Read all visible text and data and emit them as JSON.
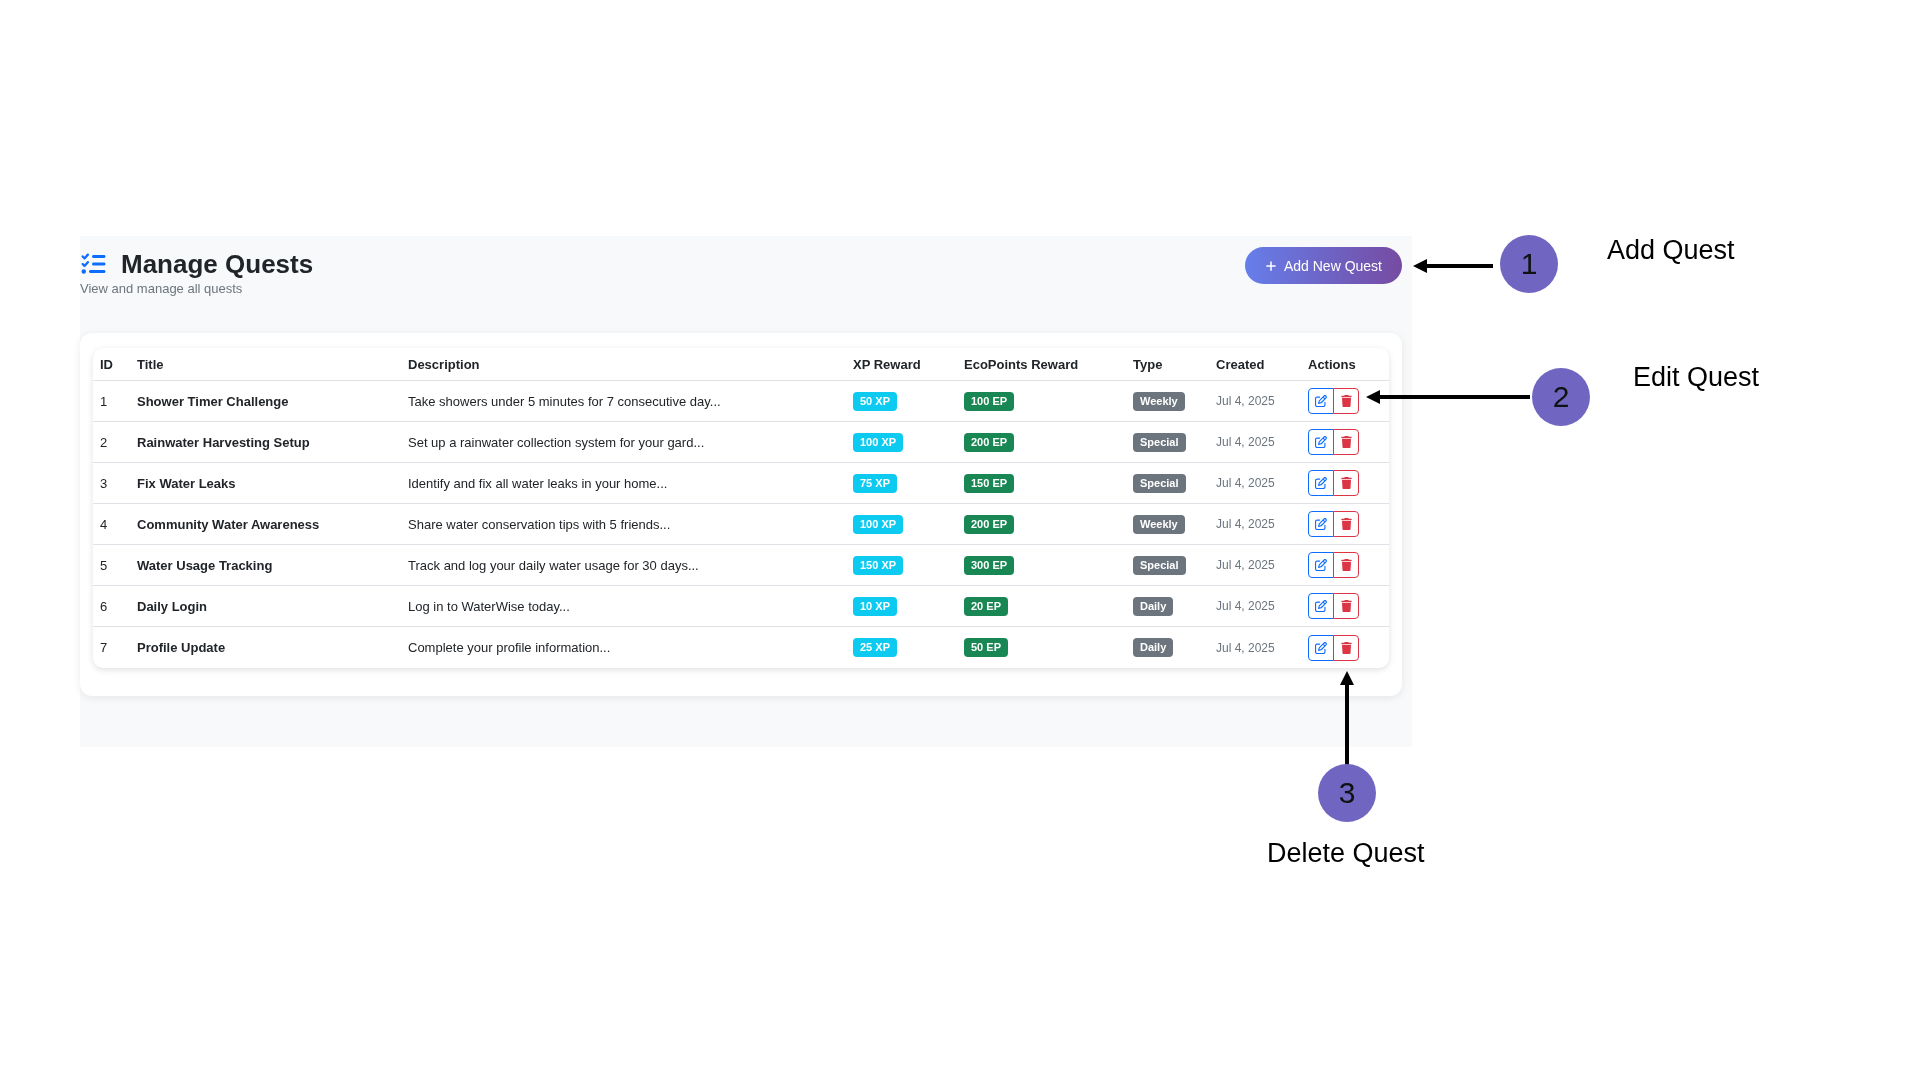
{
  "header": {
    "title": "Manage Quests",
    "subtitle": "View and manage all quests",
    "add_button": "Add New Quest"
  },
  "table": {
    "columns": [
      "ID",
      "Title",
      "Description",
      "XP Reward",
      "EcoPoints Reward",
      "Type",
      "Created",
      "Actions"
    ],
    "rows": [
      {
        "id": "1",
        "title": "Shower Timer Challenge",
        "description": "Take showers under 5 minutes for 7 consecutive day...",
        "xp_reward": "50 XP",
        "ecopoints_reward": "100 EP",
        "type": "Weekly",
        "created": "Jul 4, 2025"
      },
      {
        "id": "2",
        "title": "Rainwater Harvesting Setup",
        "description": "Set up a rainwater collection system for your gard...",
        "xp_reward": "100 XP",
        "ecopoints_reward": "200 EP",
        "type": "Special",
        "created": "Jul 4, 2025"
      },
      {
        "id": "3",
        "title": "Fix Water Leaks",
        "description": "Identify and fix all water leaks in your home...",
        "xp_reward": "75 XP",
        "ecopoints_reward": "150 EP",
        "type": "Special",
        "created": "Jul 4, 2025"
      },
      {
        "id": "4",
        "title": "Community Water Awareness",
        "description": "Share water conservation tips with 5 friends...",
        "xp_reward": "100 XP",
        "ecopoints_reward": "200 EP",
        "type": "Weekly",
        "created": "Jul 4, 2025"
      },
      {
        "id": "5",
        "title": "Water Usage Tracking",
        "description": "Track and log your daily water usage for 30 days...",
        "xp_reward": "150 XP",
        "ecopoints_reward": "300 EP",
        "type": "Special",
        "created": "Jul 4, 2025"
      },
      {
        "id": "6",
        "title": "Daily Login",
        "description": "Log in to WaterWise today...",
        "xp_reward": "10 XP",
        "ecopoints_reward": "20 EP",
        "type": "Daily",
        "created": "Jul 4, 2025"
      },
      {
        "id": "7",
        "title": "Profile Update",
        "description": "Complete your profile information...",
        "xp_reward": "25 XP",
        "ecopoints_reward": "50 EP",
        "type": "Daily",
        "created": "Jul 4, 2025"
      }
    ]
  },
  "annotations": [
    {
      "number": "1",
      "label": "Add Quest"
    },
    {
      "number": "2",
      "label": "Edit Quest"
    },
    {
      "number": "3",
      "label": "Delete Quest"
    }
  ]
}
